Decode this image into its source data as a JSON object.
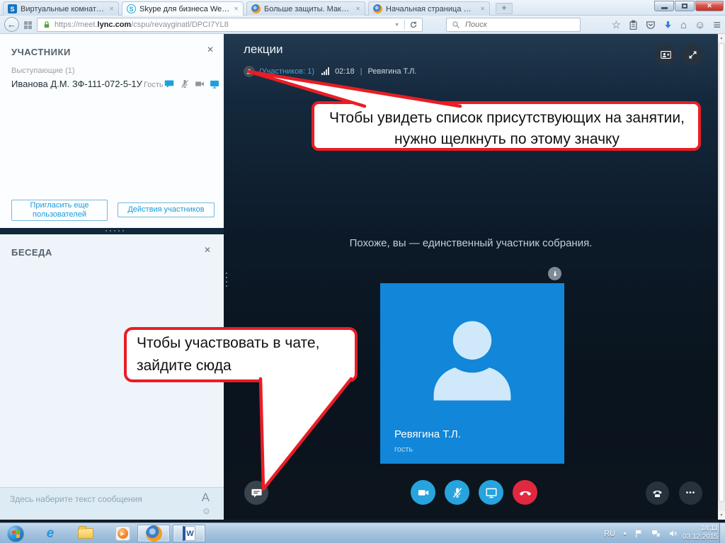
{
  "browser": {
    "tabs": [
      {
        "label": "Виртуальные комнаты Ф..."
      },
      {
        "label": "Skype для бизнеса Web App"
      },
      {
        "label": "Больше защиты. Максим..."
      },
      {
        "label": "Начальная страница Mozi..."
      }
    ],
    "sharepoint_glyph": "S",
    "skype_glyph": "S",
    "new_tab_glyph": "+",
    "tab_close_glyph": "✕",
    "window_close_glyph": "✕",
    "back_glyph": "←",
    "url_pre": "https://meet.",
    "url_highlight": "lync.com",
    "url_path": "/cspu/revayginatl/DPCI7YL8",
    "url_dropdown_glyph": "▼",
    "search_placeholder": "Поиск",
    "toolbar": {
      "star_glyph": "☆",
      "home_glyph": "⌂",
      "menu_glyph": "≡",
      "smiley_glyph": "☺"
    },
    "scroll_up_glyph": "▲",
    "scroll_down_glyph": "▼"
  },
  "participants_panel": {
    "title": "УЧАСТНИКИ",
    "close_glyph": "✕",
    "group_label": "Выступающие (1)",
    "participant_name": "Иванова Д.М. ЗФ-111-072-5-1У",
    "participant_role": "Гость",
    "invite_button_label": "Пригласить еще пользователей",
    "actions_button_label": "Действия участников"
  },
  "chat_panel": {
    "title": "БЕСЕДА",
    "close_glyph": "✕",
    "input_placeholder": "Здесь наберите текст сообщения",
    "font_glyph": "А",
    "emoticon_glyph": "☺"
  },
  "meeting": {
    "title": "лекции",
    "participants_count": "(Участников: 1)",
    "timer": "02:18",
    "separator": "|",
    "presenter_name": "Ревягина Т.Л.",
    "empty_state_message": "Похоже, вы — единственный участник собрания.",
    "tile_name": "Ревягина Т.Л.",
    "tile_role": "гость",
    "more_glyph": "•••"
  },
  "callouts": {
    "participants_hint": "Чтобы увидеть список присутствующих на занятии, нужно щелкнуть по этому значку",
    "chat_hint": "Чтобы участвовать в чате, зайдите сюда"
  },
  "taskbar": {
    "language": "RU",
    "tray_expand_glyph": "▲",
    "time": "14:11",
    "date": "03.12.2015",
    "ie_glyph": "e",
    "wmp_play_glyph": "▶",
    "word_glyph": "W"
  },
  "colors": {
    "accent_blue": "#27a3de",
    "tile_blue": "#1286d8",
    "hangup_red": "#e1283f",
    "callout_border_red": "#e91d25",
    "taskbar_blue": "#a7c6e0"
  }
}
